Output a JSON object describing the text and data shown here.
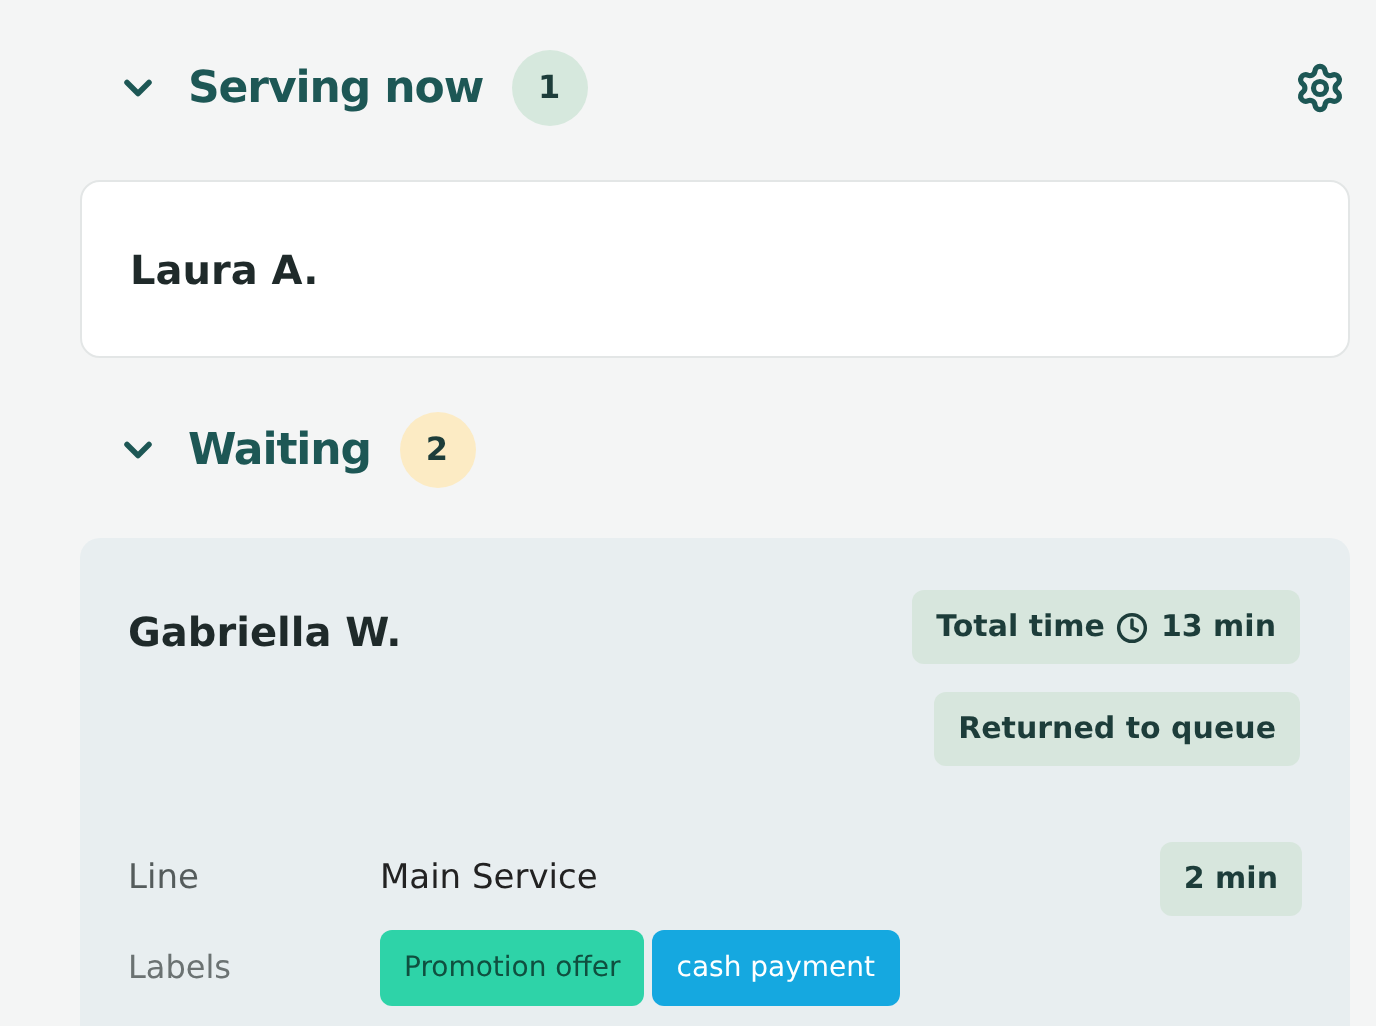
{
  "serving": {
    "title": "Serving now",
    "count": "1",
    "expanded": true,
    "customers": [
      {
        "name": "Laura A."
      }
    ]
  },
  "waiting": {
    "title": "Waiting",
    "count": "2",
    "expanded": true,
    "customers": [
      {
        "name": "Gabriella W.",
        "total_time_label": "Total time",
        "total_time": "13 min",
        "status": "Returned to queue",
        "line_label": "Line",
        "line": "Main Service",
        "line_time": "2 min",
        "labels_label": "Labels",
        "labels": [
          {
            "text": "Promotion offer",
            "color": "#2ed3a8"
          },
          {
            "text": "cash payment",
            "color": "#15a8e0"
          }
        ]
      }
    ]
  }
}
